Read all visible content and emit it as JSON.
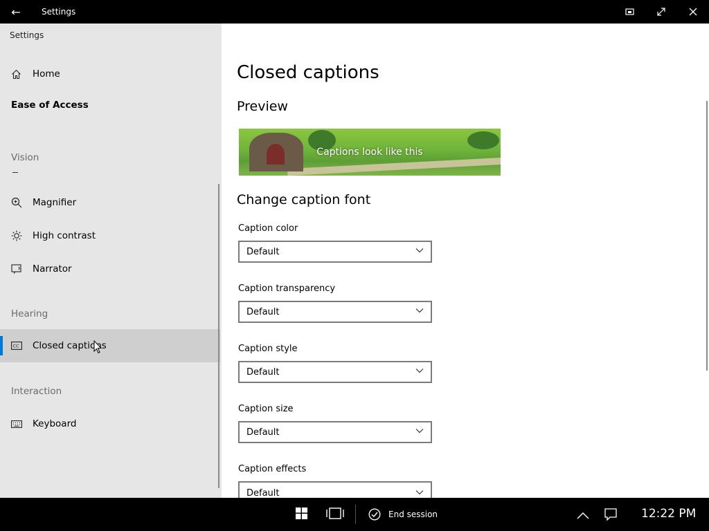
{
  "window": {
    "title": "Settings"
  },
  "sidebar": {
    "app_label": "Settings",
    "home": "Home",
    "section": "Ease of Access",
    "groups": {
      "vision": "Vision",
      "hearing": "Hearing",
      "interaction": "Interaction"
    },
    "items": {
      "magnifier": "Magnifier",
      "high_contrast": "High contrast",
      "narrator": "Narrator",
      "closed_captions": "Closed captions",
      "keyboard": "Keyboard"
    },
    "selected": "closed_captions",
    "accent_color": "#0078d7"
  },
  "main": {
    "title": "Closed captions",
    "preview_heading": "Preview",
    "preview_caption": "Captions look like this",
    "font_heading": "Change caption font",
    "fields": {
      "color": {
        "label": "Caption color",
        "value": "Default"
      },
      "transparency": {
        "label": "Caption transparency",
        "value": "Default"
      },
      "style": {
        "label": "Caption style",
        "value": "Default"
      },
      "size": {
        "label": "Caption size",
        "value": "Default"
      },
      "effects": {
        "label": "Caption effects",
        "value": "Default"
      }
    }
  },
  "taskbar": {
    "session_name": "",
    "end_session": "End session",
    "time": "12:22 PM"
  },
  "icons": [
    "back-arrow-icon",
    "pin-icon",
    "expand-icon",
    "close-icon",
    "home-icon",
    "magnifier-icon",
    "brightness-icon",
    "narrator-icon",
    "closed-captions-icon",
    "keyboard-icon",
    "chevron-down-icon",
    "windows-icon",
    "task-view-icon",
    "check-circle-icon",
    "chevron-up-icon",
    "notification-icon",
    "mouse-cursor-icon"
  ]
}
